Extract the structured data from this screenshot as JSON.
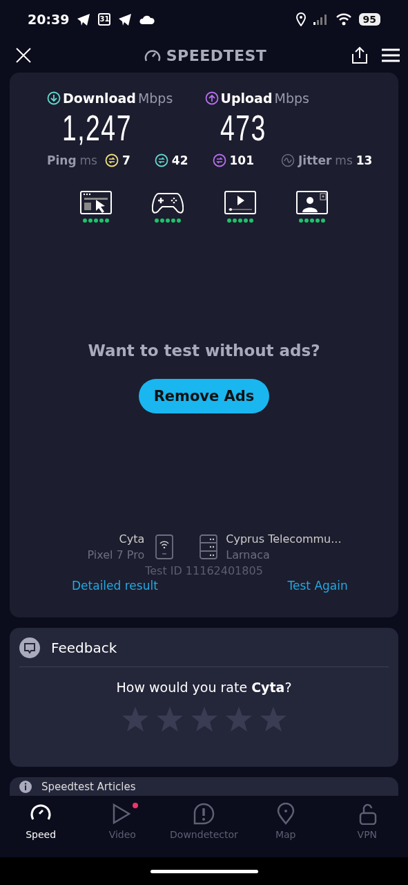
{
  "status_bar": {
    "time": "20:39",
    "calendar_day": "31",
    "battery": "95"
  },
  "header": {
    "title": "SPEEDTEST"
  },
  "results": {
    "download": {
      "label": "Download",
      "unit": "Mbps",
      "value": "1,247"
    },
    "upload": {
      "label": "Upload",
      "unit": "Mbps",
      "value": "473"
    },
    "ping": {
      "label": "Ping",
      "unit": "ms",
      "readings": [
        {
          "value": "7",
          "color": "#f2e07a"
        },
        {
          "value": "42",
          "color": "#5fd8d0"
        },
        {
          "value": "101",
          "color": "#b86ef0"
        }
      ]
    },
    "jitter": {
      "label": "Jitter",
      "unit": "ms",
      "value": "13"
    },
    "quality": [
      {
        "kind": "browsing",
        "stars": 5
      },
      {
        "kind": "gaming",
        "stars": 5
      },
      {
        "kind": "video",
        "stars": 5
      },
      {
        "kind": "calls",
        "stars": 5
      }
    ],
    "promo": "Want to test without ads?",
    "remove_ads": "Remove Ads",
    "provider": {
      "name": "Cyta",
      "device": "Pixel 7 Pro"
    },
    "server": {
      "name": "Cyprus Telecommu...",
      "location": "Larnaca"
    },
    "test_id": "Test ID 11162401805",
    "detailed_result": "Detailed result",
    "test_again": "Test Again"
  },
  "feedback": {
    "title": "Feedback",
    "question": "How would you rate **Cyta**?"
  },
  "articles": {
    "title": "Speedtest Articles"
  },
  "nav": [
    {
      "kind": "speed",
      "label": "Speed",
      "selected": true,
      "badge": false
    },
    {
      "kind": "video",
      "label": "Video",
      "selected": false,
      "badge": true
    },
    {
      "kind": "downdetector",
      "label": "Downdetector",
      "selected": false,
      "badge": false
    },
    {
      "kind": "map",
      "label": "Map",
      "selected": false,
      "badge": false
    },
    {
      "kind": "vpn",
      "label": "VPN",
      "selected": false,
      "badge": false
    }
  ]
}
